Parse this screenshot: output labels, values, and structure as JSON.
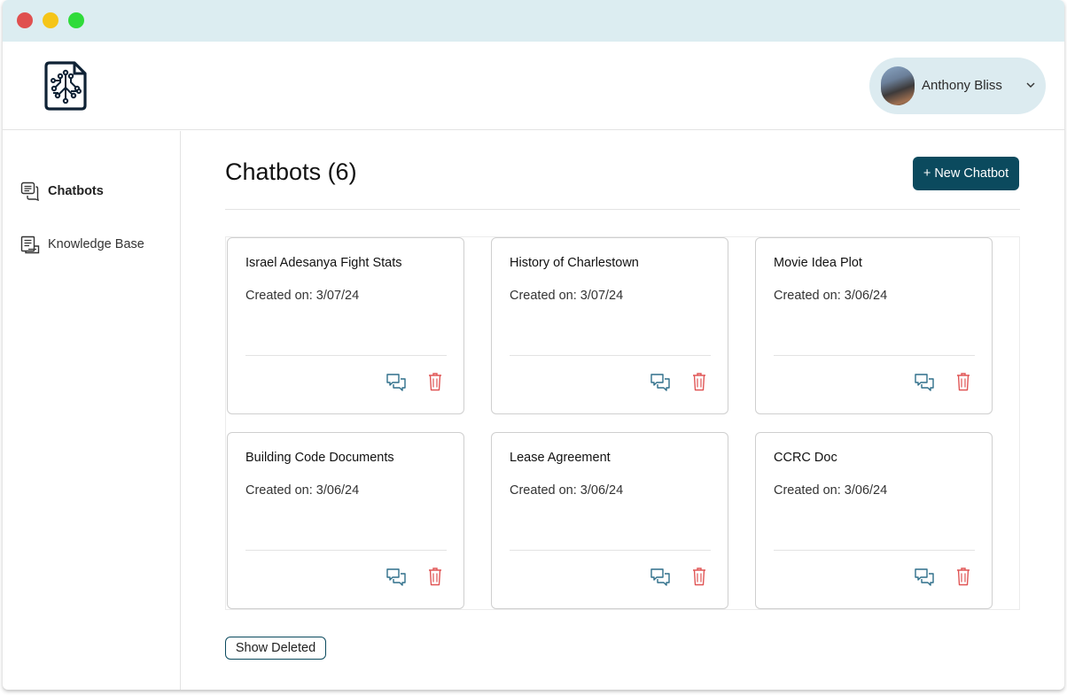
{
  "header": {
    "user": {
      "name": "Anthony Bliss"
    }
  },
  "sidebar": {
    "items": [
      {
        "label": "Chatbots",
        "icon": "chat-list-icon",
        "active": true
      },
      {
        "label": "Knowledge Base",
        "icon": "document-stack-icon",
        "active": false
      }
    ]
  },
  "main": {
    "title": "Chatbots (6)",
    "new_button_label": "+ New Chatbot",
    "show_deleted_label": "Show Deleted",
    "cards": [
      {
        "name": "Israel Adesanya Fight Stats",
        "created": "Created on: 3/07/24"
      },
      {
        "name": "History of Charlestown",
        "created": "Created on: 3/07/24"
      },
      {
        "name": "Movie Idea Plot",
        "created": "Created on: 3/06/24"
      },
      {
        "name": "Building Code Documents",
        "created": "Created on: 3/06/24"
      },
      {
        "name": "Lease Agreement",
        "created": "Created on: 3/06/24"
      },
      {
        "name": "CCRC Doc",
        "created": "Created on: 3/06/24"
      }
    ]
  },
  "colors": {
    "titlebar": "#dcedf1",
    "accent": "#0b4a5e",
    "chat_icon": "#2f6f8a",
    "delete_icon": "#e05555",
    "user_chip": "#dcebf0"
  }
}
